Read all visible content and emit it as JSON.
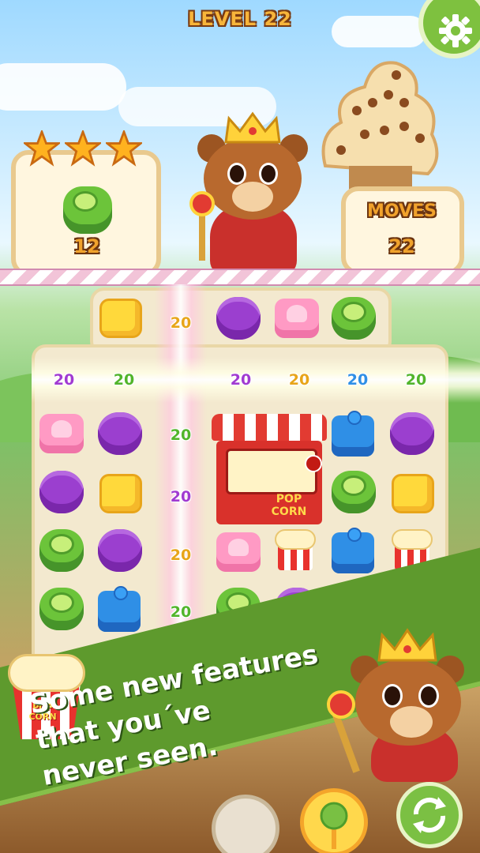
{
  "header": {
    "level_title": "LEVEL 22"
  },
  "goal_panel": {
    "stars_earned": 3,
    "stars_total": 3,
    "target_icon": "green-lime-candy-icon",
    "target_count": "12"
  },
  "moves_panel": {
    "label": "MOVES",
    "value": "22"
  },
  "board": {
    "score_popups": [
      "20",
      "20",
      "20",
      "20",
      "20",
      "20",
      "20",
      "20",
      "20",
      "20",
      "20"
    ],
    "special_item_label": "POP CORN"
  },
  "promo": {
    "line1": "Some new features",
    "line2": "that you´ve",
    "line3": "never seen."
  },
  "popcorn_bucket_label": "POP CORN",
  "colors": {
    "score_purple": "#a13bd1",
    "score_green": "#52b52b",
    "score_yellow": "#e8a51a",
    "score_blue": "#2f8fe6",
    "accent_green": "#5e9a2d",
    "title_gold": "#f7b53a"
  },
  "icons": [
    "gear-icon",
    "star-icon",
    "shuffle-icon",
    "popcorn-machine-icon",
    "bear-king-icon"
  ]
}
